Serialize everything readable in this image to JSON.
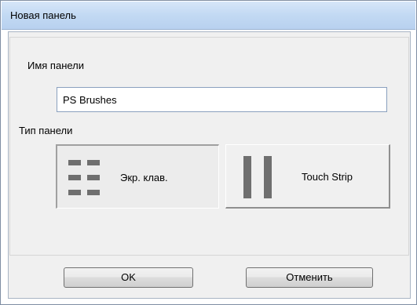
{
  "window": {
    "title": "Новая панель"
  },
  "form": {
    "name_label": "Имя панели",
    "name_value": "PS Brushes",
    "type_label": "Тип панели"
  },
  "panel_types": {
    "keys_label": "Экр. клав.",
    "keys_icon": "keyboard-grid-icon",
    "keys_selected": true,
    "strip_label": "Touch Strip",
    "strip_icon": "touch-strip-icon"
  },
  "buttons": {
    "ok_label": "OK",
    "cancel_label": "Отменить"
  }
}
